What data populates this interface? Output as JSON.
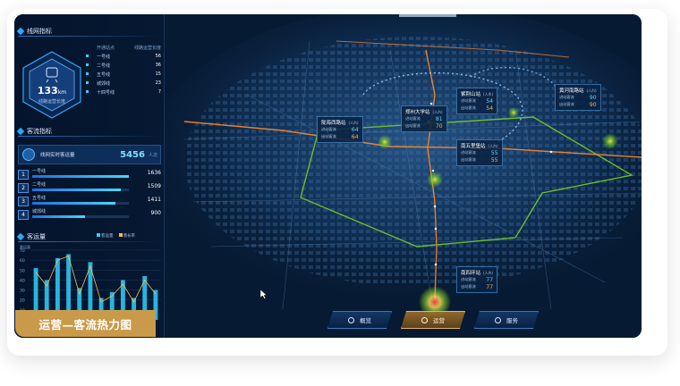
{
  "left_panel": {
    "network_title": "线网指标",
    "hex": {
      "value": "133",
      "unit": "km",
      "label": "线路运营长度"
    },
    "line_table": {
      "headers": [
        "",
        "开通站点",
        "线路运营长度"
      ],
      "rows": [
        {
          "name": "一号线",
          "value": "56"
        },
        {
          "name": "二号线",
          "value": "36"
        },
        {
          "name": "五号线",
          "value": "15"
        },
        {
          "name": "城郊线",
          "value": "23"
        },
        {
          "name": "十四号线",
          "value": "7"
        }
      ]
    },
    "flow_title": "客流指标",
    "flow_total": {
      "label": "线网实时客运量",
      "value": "5456",
      "unit": "人次"
    },
    "ranking": [
      {
        "no": "1",
        "name": "一号线",
        "value": "1636",
        "ratio": 1.0
      },
      {
        "no": "2",
        "name": "二号线",
        "value": "1509",
        "ratio": 0.92
      },
      {
        "no": "3",
        "name": "五号线",
        "value": "1411",
        "ratio": 0.86
      },
      {
        "no": "4",
        "name": "城郊线",
        "value": "900",
        "ratio": 0.55
      }
    ],
    "volume_title": "客运量",
    "legend": [
      "客运量",
      "增长率"
    ],
    "legend_colors": [
      "#2fd0ff",
      "#ffb94d"
    ]
  },
  "chart_data": {
    "type": "bar",
    "title": "客运量",
    "ylabel": "客运量",
    "yticks": [
      "70",
      "60",
      "50",
      "40",
      "30",
      "20",
      "10"
    ],
    "ylim": [
      0,
      70
    ],
    "values": [
      52,
      40,
      62,
      66,
      32,
      58,
      22,
      28,
      40,
      22,
      44,
      30
    ],
    "line_values": [
      48,
      34,
      60,
      64,
      26,
      54,
      18,
      24,
      36,
      18,
      40,
      26
    ],
    "series": [
      {
        "name": "客运量"
      },
      {
        "name": "增长率"
      }
    ]
  },
  "stations": [
    {
      "name": "紫荆山站",
      "unit": "(人/h)",
      "in_label": "进站客流",
      "in": "54",
      "out_label": "出站客流",
      "out": "54"
    },
    {
      "name": "郑州大学站",
      "unit": "(人/h)",
      "in_label": "进站客流",
      "in": "81",
      "out_label": "出站客流",
      "out": "70"
    },
    {
      "name": "陇海西路站",
      "unit": "(人/h)",
      "in_label": "进站客流",
      "in": "64",
      "out_label": "出站客流",
      "out": "64"
    },
    {
      "name": "南五里堡站",
      "unit": "(人/h)",
      "in_label": "进站客流",
      "in": "55",
      "out_label": "出站客流",
      "out": "55"
    },
    {
      "name": "黄河南路站",
      "unit": "(人/h)",
      "in_label": "进站客流",
      "in": "90",
      "out_label": "出站客流",
      "out": "90"
    },
    {
      "name": "南四环站",
      "unit": "(人/h)",
      "in_label": "进站客流",
      "in": "77",
      "out_label": "出站客流",
      "out": "77"
    }
  ],
  "nav": {
    "overview": "概览",
    "operation": "运营",
    "service": "服务"
  },
  "caption": "运营—客流热力图",
  "colors": {
    "accent": "#2ea7ff",
    "active": "#c99a4a",
    "metro_orange": "#ff8a2a",
    "metro_green": "#7ed321"
  }
}
